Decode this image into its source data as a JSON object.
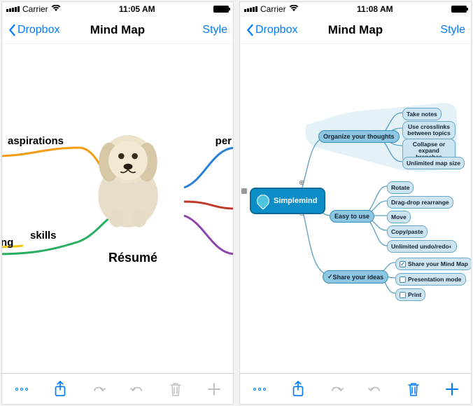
{
  "phone1": {
    "status": {
      "carrier": "Carrier",
      "time": "11:05 AM"
    },
    "nav": {
      "back": "Dropbox",
      "title": "Mind Map",
      "style": "Style"
    },
    "map": {
      "center": "Résumé",
      "nodes": {
        "aspirations": "aspirations",
        "skills": "skills",
        "ng": "ng",
        "per": "per"
      }
    }
  },
  "phone2": {
    "status": {
      "carrier": "Carrier",
      "time": "11:08 AM"
    },
    "nav": {
      "back": "Dropbox",
      "title": "Mind Map",
      "style": "Style"
    },
    "map": {
      "root": "Simplemind",
      "branches": [
        {
          "label": "Organize your thoughts",
          "children": [
            "Take notes",
            "Use crosslinks between topics",
            "Collapse or expand branches",
            "Unlimited map size"
          ]
        },
        {
          "label": "Easy to use",
          "children": [
            "Rotate",
            "Drag-drop rearrange",
            "Move",
            "Copy/paste",
            "Unlimited undo/redo"
          ]
        },
        {
          "label": "Share your ideas",
          "children": [
            {
              "text": "Share your Mind Map",
              "checked": true
            },
            {
              "text": "Presentation mode",
              "checked": false
            },
            {
              "text": "Print",
              "checked": false
            }
          ]
        }
      ]
    }
  }
}
